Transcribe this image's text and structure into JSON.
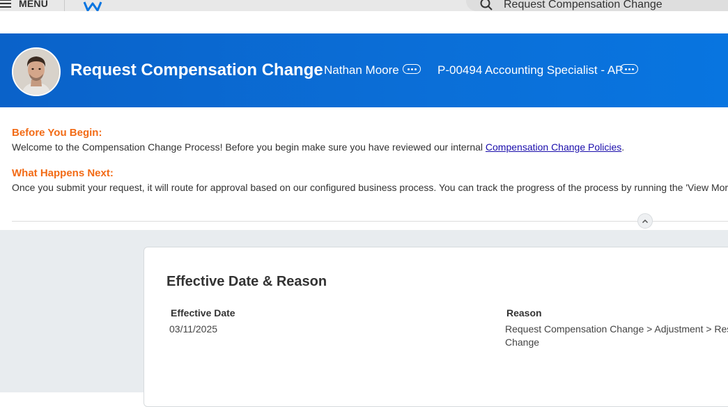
{
  "topbar": {
    "menu_label": "MENU",
    "search_text": "Request Compensation Change",
    "brand_color": "#0875e1",
    "accent_color": "#f38b00"
  },
  "header": {
    "title": "Request Compensation Change",
    "worker_name": "Nathan Moore",
    "position": "P-00494 Accounting Specialist - AP",
    "related_actions_icon": "ellipsis-icon"
  },
  "instructions": {
    "before_heading": "Before You Begin:",
    "before_text": "Welcome to the Compensation Change Process!  Before you begin make sure you have reviewed our internal ",
    "before_link": "Compensation Change Policies",
    "before_suffix": ".",
    "next_heading": "What Happens Next:",
    "next_text": "Once you submit your request, it will route for approval based on our configured business process.  You can track the progress of the process by running the 'View Mor"
  },
  "card": {
    "title": "Effective Date & Reason",
    "effective_date_label": "Effective Date",
    "effective_date_value": "03/11/2025",
    "reason_label": "Reason",
    "reason_value_line1": "Request Compensation Change > Adjustment > Res",
    "reason_value_line2": "Change"
  }
}
